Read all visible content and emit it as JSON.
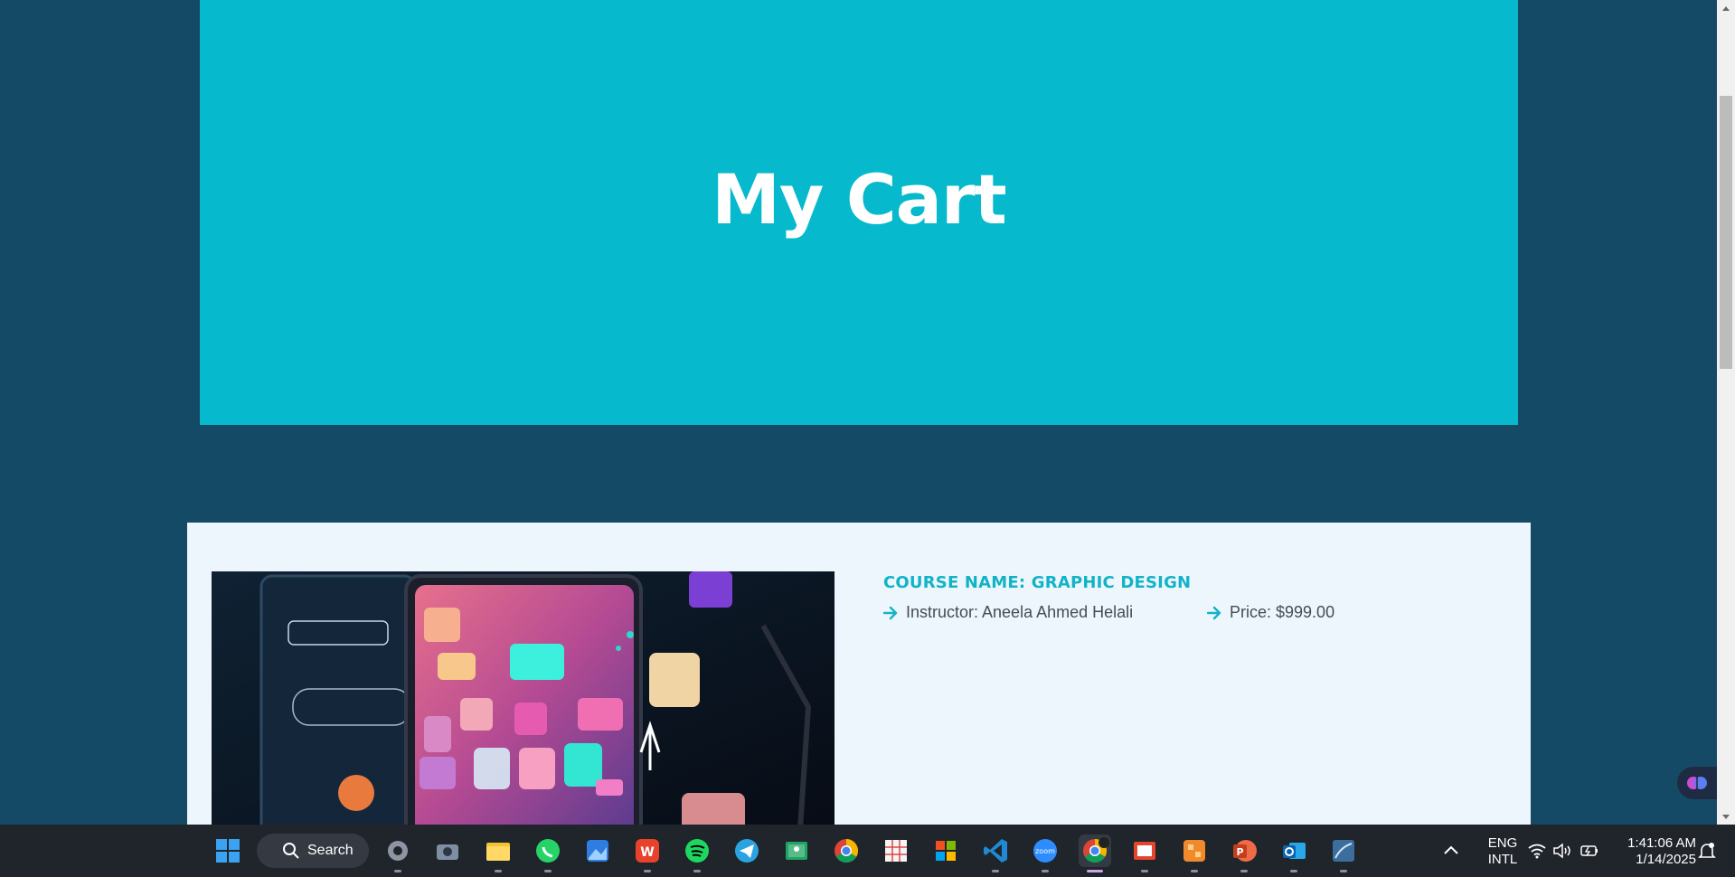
{
  "hero": {
    "title": "My Cart"
  },
  "cart": {
    "items": [
      {
        "course_name": "COURSE NAME: GRAPHIC DESIGN",
        "instructor": "Instructor: Aneela Ahmed Helali",
        "price": "Price: $999.00"
      }
    ]
  },
  "colors": {
    "accent": "#06b9cc",
    "background": "#154a66",
    "card": "#eef6fd"
  },
  "taskbar": {
    "search_label": "Search",
    "language": "ENG",
    "layout": "INTL",
    "time": "1:41:06 AM",
    "date": "1/14/2025"
  }
}
